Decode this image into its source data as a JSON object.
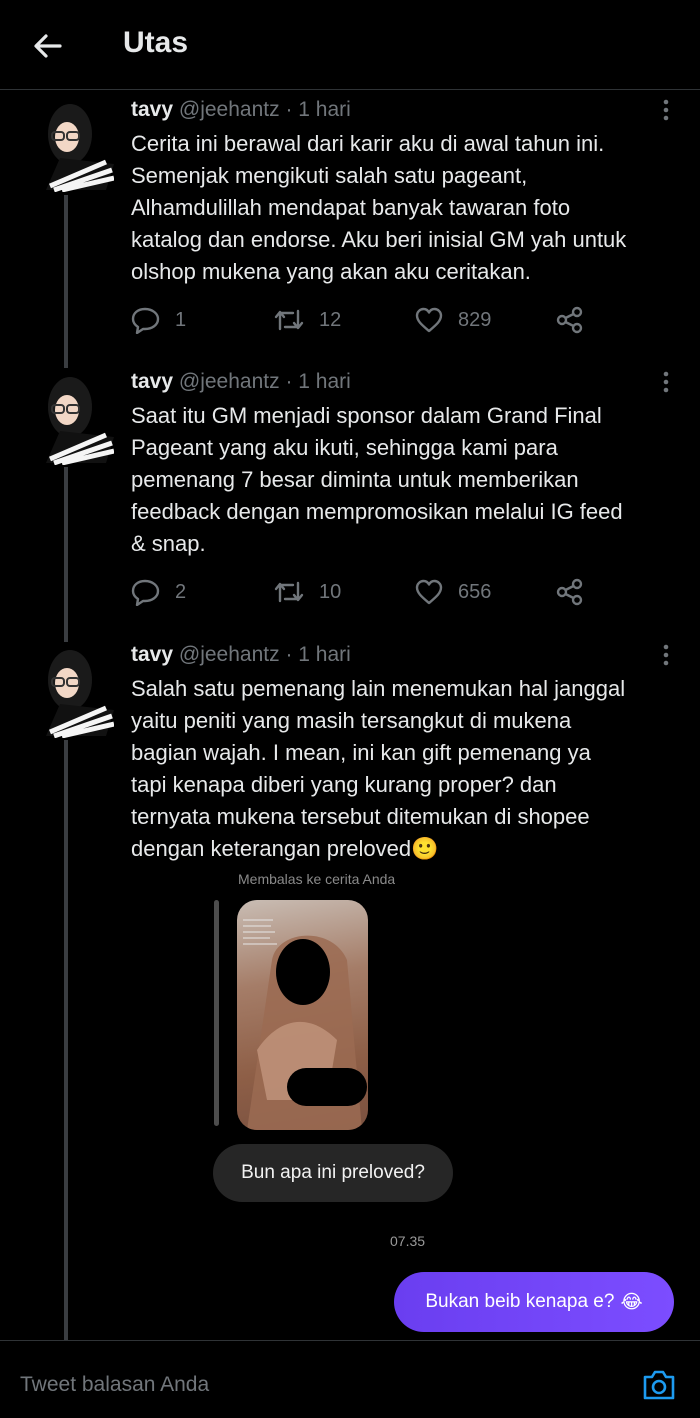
{
  "header": {
    "title": "Utas"
  },
  "tweets": [
    {
      "name": "tavy",
      "handle": "@jeehantz",
      "separator": "·",
      "time": "1 hari",
      "text": "Cerita ini berawal dari karir aku di awal tahun ini.\nSemenjak mengikuti salah satu pageant,\nAlhamdulillah mendapat banyak tawaran foto\nkatalog dan endorse. Aku beri inisial GM yah untuk\nolshop mukena yang akan aku ceritakan.",
      "replies": "1",
      "retweets": "12",
      "likes": "829"
    },
    {
      "name": "tavy",
      "handle": "@jeehantz",
      "separator": "·",
      "time": "1 hari",
      "text": "Saat itu GM menjadi sponsor dalam Grand Final\nPageant yang aku ikuti, sehingga kami para\npemenang 7 besar diminta untuk memberikan\nfeedback dengan mempromosikan melalui IG feed\n& snap.",
      "replies": "2",
      "retweets": "10",
      "likes": "656"
    },
    {
      "name": "tavy",
      "handle": "@jeehantz",
      "separator": "·",
      "time": "1 hari",
      "text": "Salah satu pemenang lain menemukan hal janggal\nyaitu peniti yang masih tersangkut di mukena\nbagian wajah. I mean, ini kan gift pemenang ya\ntapi kenapa diberi yang kurang proper? dan\nternyata mukena tersebut ditemukan di shopee\ndengan keterangan preloved🙂"
    }
  ],
  "dm": {
    "caption": "Membalas ke cerita Anda",
    "incoming": "Bun apa ini preloved?",
    "time": "07.35",
    "outgoing": "Bukan beib kenapa e?",
    "outgoing_emoji": "😂"
  },
  "reply": {
    "placeholder": "Tweet balasan Anda"
  },
  "colors": {
    "background": "#000000",
    "muted": "#71767b",
    "text": "#e7e9ea",
    "accent": "#1d9bf0",
    "dm_purple": "#7c4dff"
  }
}
